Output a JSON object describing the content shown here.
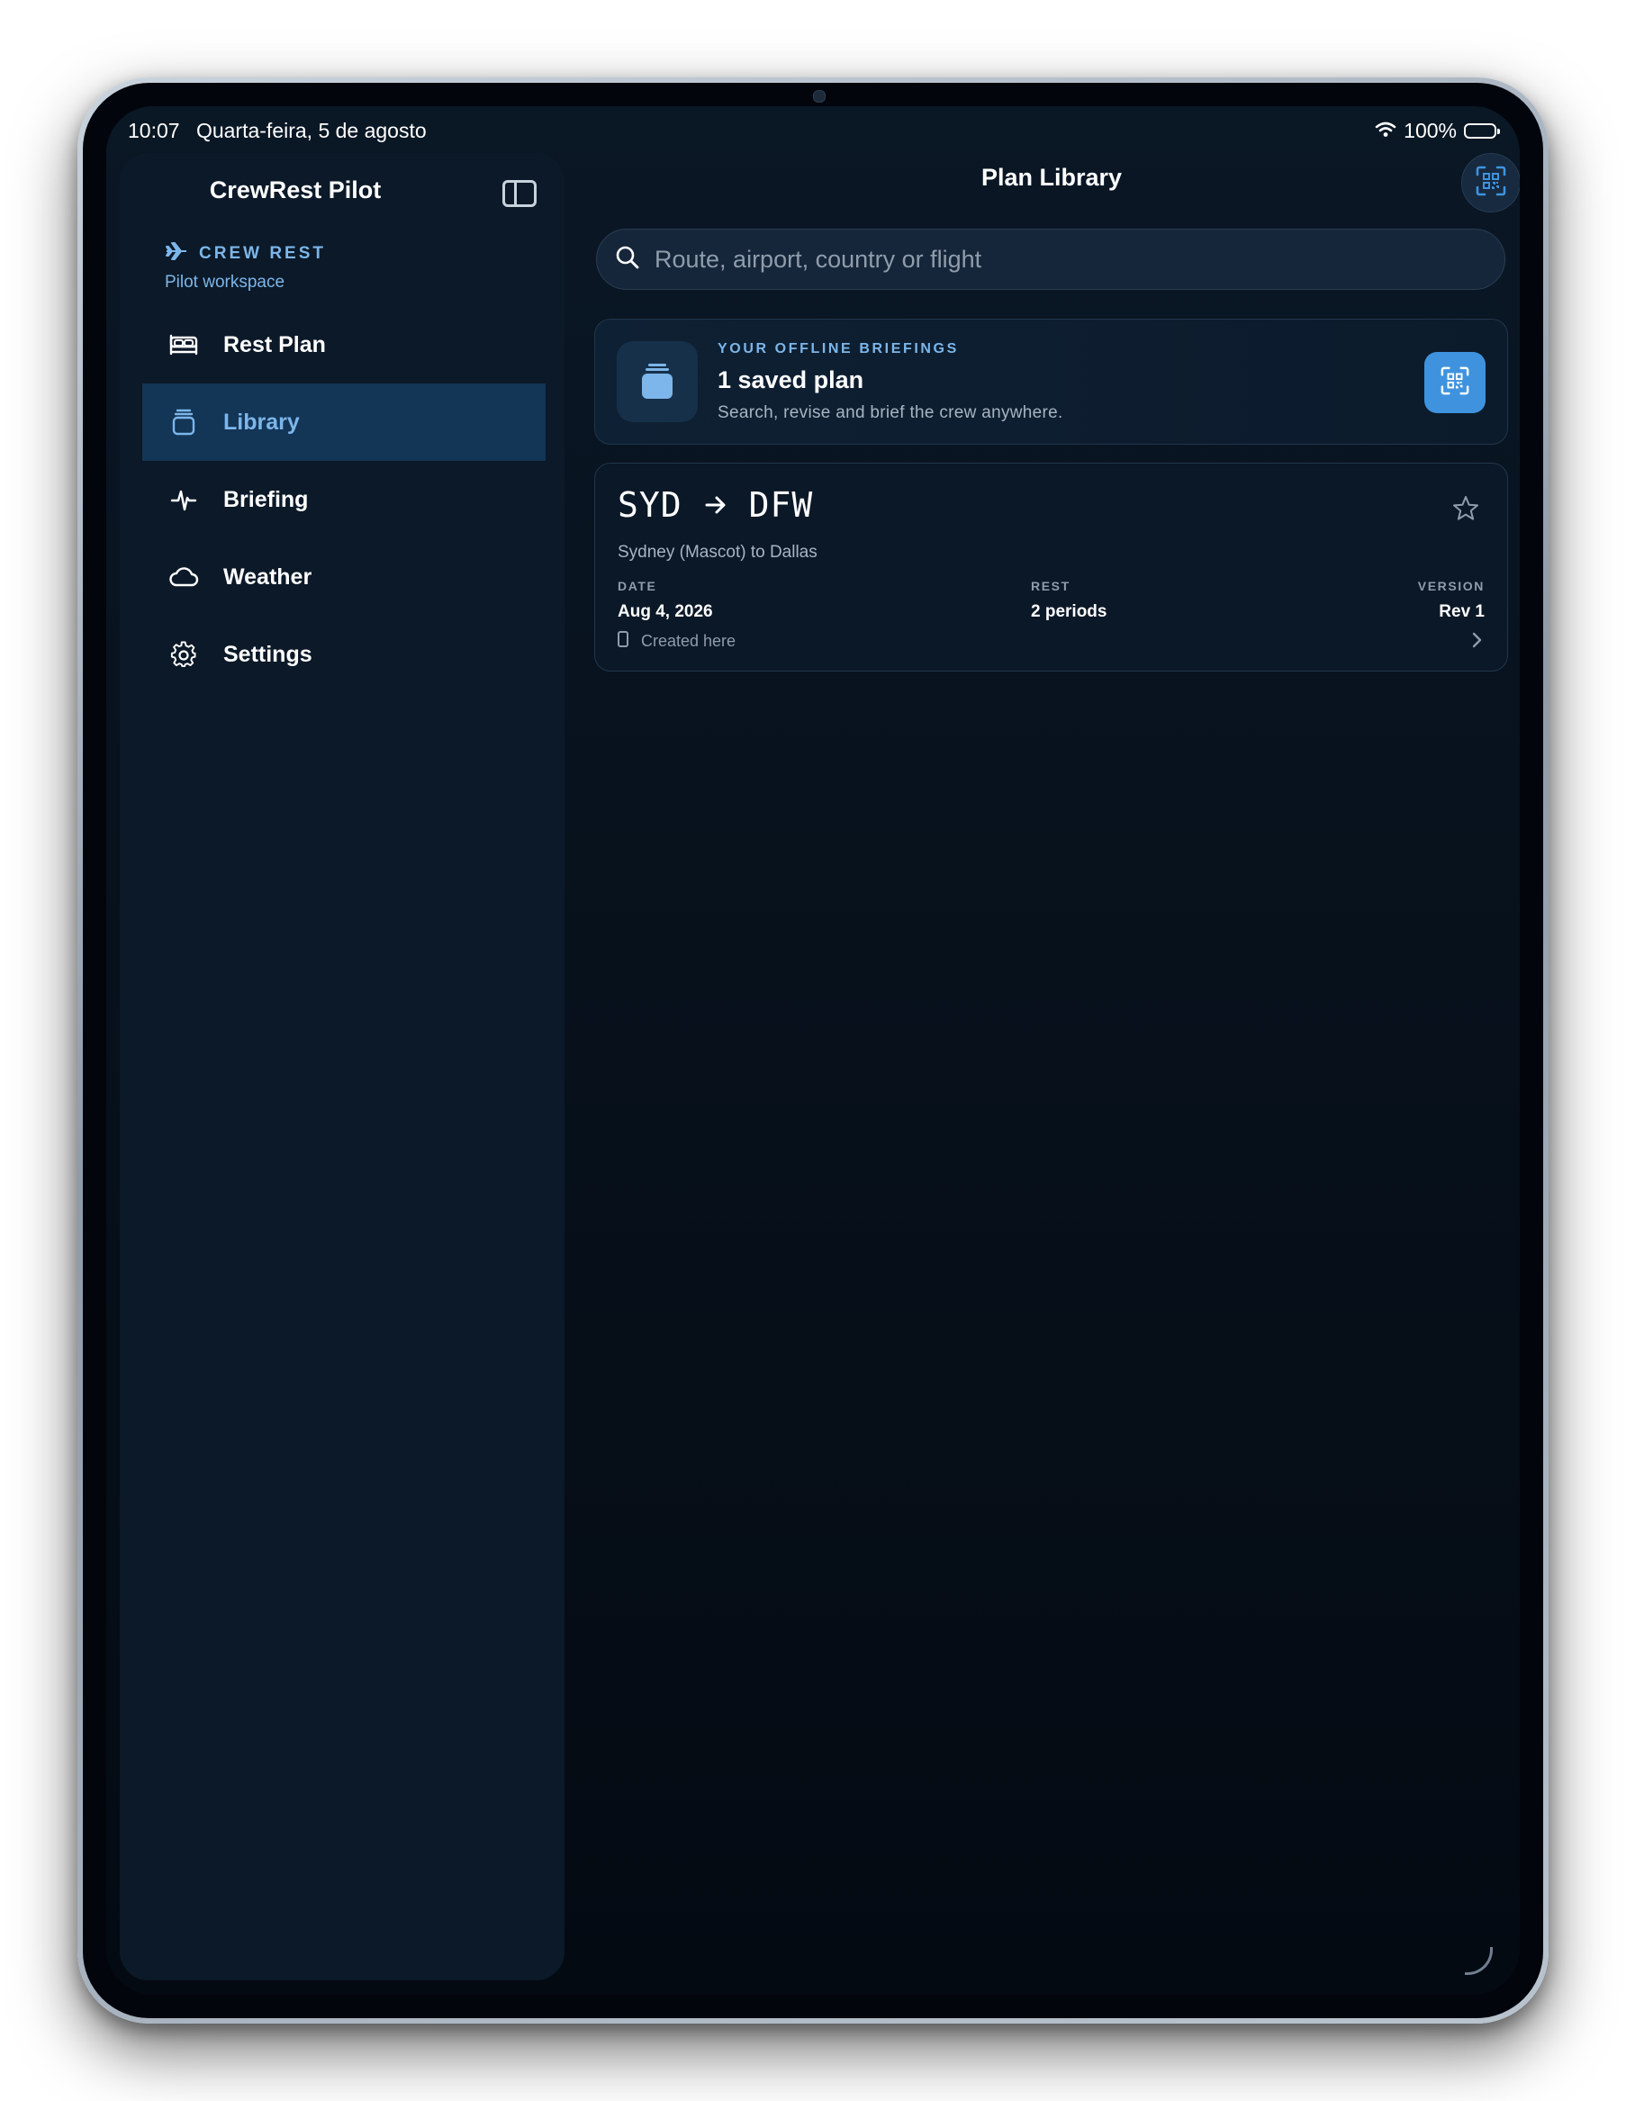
{
  "status_bar": {
    "time": "10:07",
    "date": "Quarta-feira, 5 de agosto",
    "battery": "100%",
    "icons": [
      "wifi-icon",
      "battery-icon"
    ]
  },
  "sidebar": {
    "title": "CrewRest Pilot",
    "toggle_icon": "sidebar-toggle-icon",
    "brand": {
      "label": "CREW REST",
      "subtitle": "Pilot workspace",
      "icon": "airplane-icon"
    },
    "items": [
      {
        "label": "Rest Plan",
        "icon": "bed-icon",
        "active": false
      },
      {
        "label": "Library",
        "icon": "library-icon",
        "active": true
      },
      {
        "label": "Briefing",
        "icon": "waveform-icon",
        "active": false
      },
      {
        "label": "Weather",
        "icon": "cloud-icon",
        "active": false
      },
      {
        "label": "Settings",
        "icon": "gear-icon",
        "active": false
      }
    ]
  },
  "main": {
    "title": "Plan Library",
    "scan_icon": "qr-scan-icon",
    "search": {
      "placeholder": "Route, airport, country or flight",
      "value": ""
    },
    "summary": {
      "eyebrow": "YOUR OFFLINE BRIEFINGS",
      "title": "1 saved plan",
      "description": "Search, revise and brief the crew anywhere.",
      "icon": "stack-icon",
      "action_icon": "qr-scan-icon"
    },
    "plans": [
      {
        "from": "SYD",
        "to": "DFW",
        "subtitle": "Sydney (Mascot) to Dallas",
        "favorite": false,
        "date_label": "DATE",
        "date": "Aug 4, 2026",
        "rest_label": "REST",
        "rest": "2 periods",
        "version_label": "VERSION",
        "version": "Rev 1",
        "origin": "Created here"
      }
    ]
  },
  "colors": {
    "accent": "#7cb6ea",
    "button": "#3f93de",
    "background": "#07111c",
    "sidebar": "#0b1928",
    "active_row": "#133556"
  }
}
